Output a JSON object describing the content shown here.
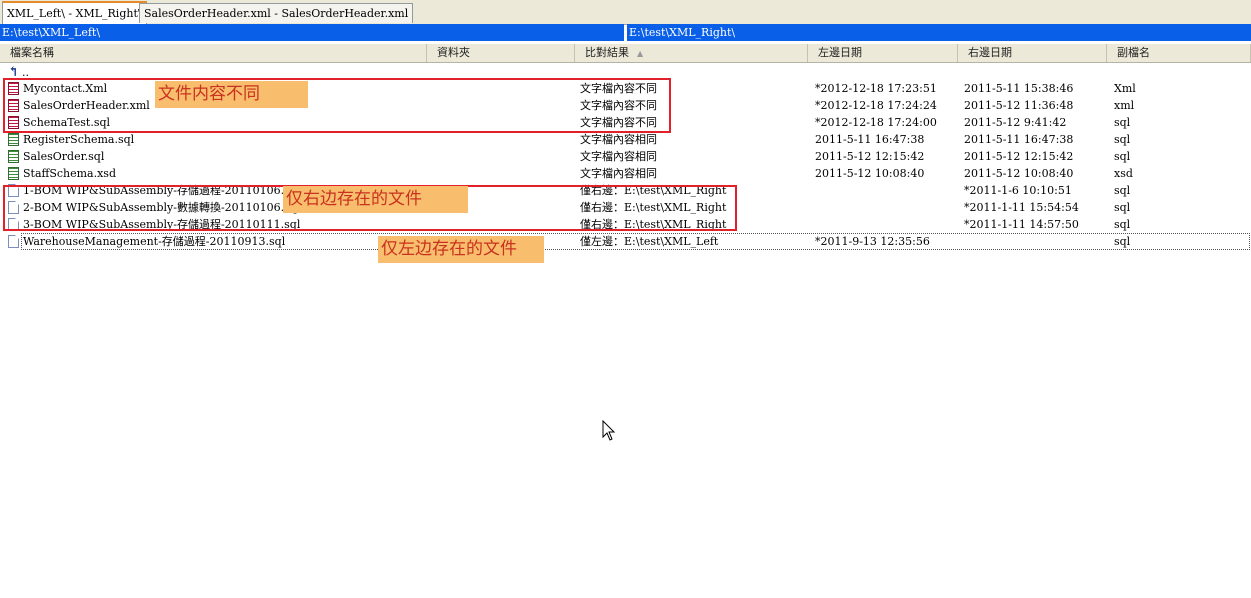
{
  "tabs": [
    {
      "label": "XML_Left\\ - XML_Right\\",
      "active": true
    },
    {
      "label": "SalesOrderHeader.xml - SalesOrderHeader.xml",
      "active": false
    }
  ],
  "paths": {
    "left": "E:\\test\\XML_Left\\",
    "right": "E:\\test\\XML_Right\\"
  },
  "columns": {
    "name": "檔案名稱",
    "folder": "資料夾",
    "result": "比對結果",
    "left_date": "左邊日期",
    "right_date": "右邊日期",
    "ext": "副檔名"
  },
  "up_label": "..",
  "rows": [
    {
      "name": "Mycontact.Xml",
      "icon": "diff-file-icon",
      "result": "文字檔內容不同",
      "left_date": "*2012-12-18 17:23:51",
      "right_date": "2011-5-11 15:38:46",
      "ext": "Xml"
    },
    {
      "name": "SalesOrderHeader.xml",
      "icon": "diff-file-icon",
      "result": "文字檔內容不同",
      "left_date": "*2012-12-18 17:24:24",
      "right_date": "2011-5-12 11:36:48",
      "ext": "xml"
    },
    {
      "name": "SchemaTest.sql",
      "icon": "diff-file-icon",
      "result": "文字檔內容不同",
      "left_date": "*2012-12-18 17:24:00",
      "right_date": "2011-5-12 9:41:42",
      "ext": "sql"
    },
    {
      "name": "RegisterSchema.sql",
      "icon": "same-file-icon",
      "result": "文字檔內容相同",
      "left_date": "2011-5-11 16:47:38",
      "right_date": "2011-5-11 16:47:38",
      "ext": "sql"
    },
    {
      "name": "SalesOrder.sql",
      "icon": "same-file-icon",
      "result": "文字檔內容相同",
      "left_date": "2011-5-12 12:15:42",
      "right_date": "2011-5-12 12:15:42",
      "ext": "sql"
    },
    {
      "name": "StaffSchema.xsd",
      "icon": "same-file-icon",
      "result": "文字檔內容相同",
      "left_date": "2011-5-12 10:08:40",
      "right_date": "2011-5-12 10:08:40",
      "ext": "xsd"
    },
    {
      "name": "1-BOM WIP&SubAssembly-存儲過程-20110106.sql",
      "icon": "right-only-file-icon",
      "result": "僅右邊：E:\\test\\XML_Right",
      "left_date": "",
      "right_date": "*2011-1-6 10:10:51",
      "ext": "sql"
    },
    {
      "name": "2-BOM WIP&SubAssembly-數據轉換-20110106.sql",
      "icon": "right-only-file-icon",
      "result": "僅右邊：E:\\test\\XML_Right",
      "left_date": "",
      "right_date": "*2011-1-11 15:54:54",
      "ext": "sql"
    },
    {
      "name": "3-BOM WIP&SubAssembly-存儲過程-20110111.sql",
      "icon": "right-only-file-icon",
      "result": "僅右邊：E:\\test\\XML_Right",
      "left_date": "",
      "right_date": "*2011-1-11 14:57:50",
      "ext": "sql"
    },
    {
      "name": "WarehouseManagement-存儲過程-20110913.sql",
      "icon": "left-only-file-icon",
      "result": "僅左邊：E:\\test\\XML_Left",
      "left_date": "*2011-9-13 12:35:56",
      "right_date": "",
      "ext": "sql"
    }
  ],
  "annotations": {
    "diff": "文件内容不同",
    "right_only": "仅右边存在的文件",
    "left_only": "仅左边存在的文件"
  }
}
